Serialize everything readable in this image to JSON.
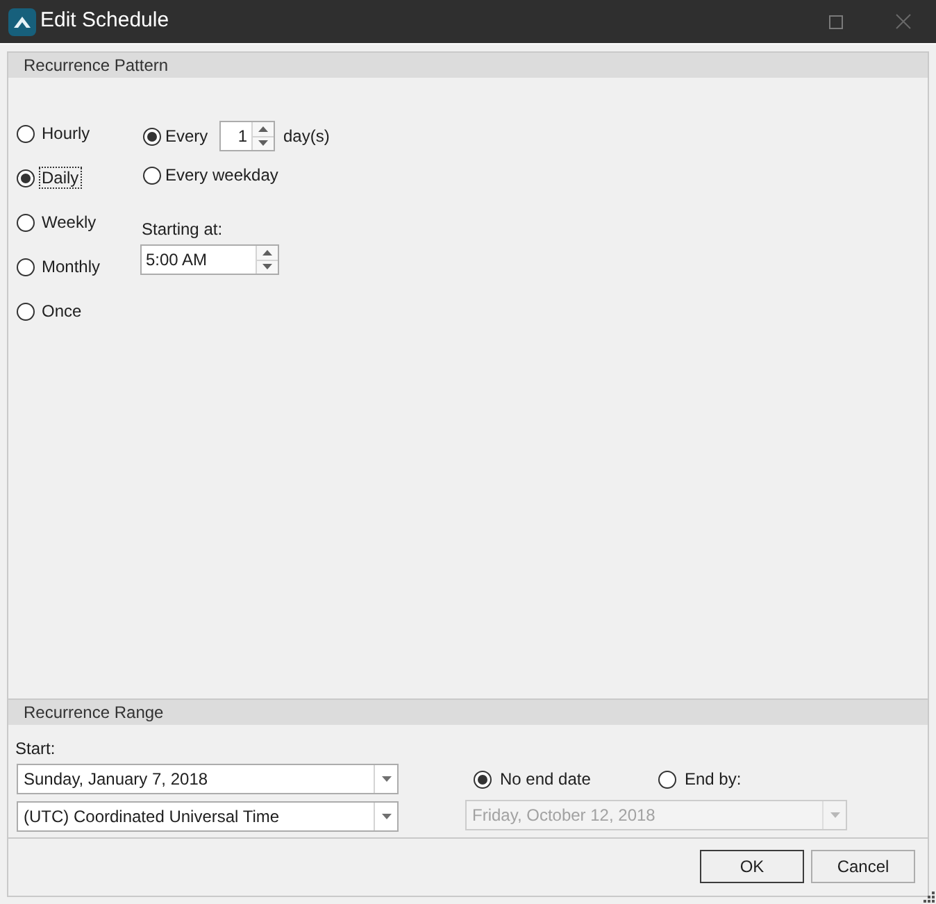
{
  "window": {
    "title": "Edit Schedule"
  },
  "recurrence_pattern": {
    "title": "Recurrence Pattern",
    "frequencies": [
      {
        "label": "Hourly",
        "selected": false,
        "focused": false
      },
      {
        "label": "Daily",
        "selected": true,
        "focused": true
      },
      {
        "label": "Weekly",
        "selected": false,
        "focused": false
      },
      {
        "label": "Monthly",
        "selected": false,
        "focused": false
      },
      {
        "label": "Once",
        "selected": false,
        "focused": false
      }
    ],
    "daily_settings": {
      "options": [
        {
          "kind": "interval",
          "label": "Every",
          "selected": true,
          "value": "1",
          "unit": "day(s)"
        },
        {
          "kind": "weekday",
          "label": "Every weekday",
          "selected": false
        }
      ],
      "starting_at": {
        "label": "Starting at:",
        "value": "5:00 AM"
      }
    }
  },
  "recurrence_range": {
    "title": "Recurrence Range",
    "start": {
      "label": "Start:",
      "date": "Sunday, January 7, 2018",
      "time_zone": "(UTC) Coordinated Universal Time"
    },
    "end_options": [
      {
        "label": "No end date",
        "selected": true
      },
      {
        "label": "End by:",
        "selected": false
      }
    ],
    "end_date": {
      "value": "Friday, October 12, 2018",
      "disabled": true
    }
  },
  "buttons": [
    {
      "label": "OK",
      "default": true
    },
    {
      "label": "Cancel",
      "default": false
    }
  ]
}
